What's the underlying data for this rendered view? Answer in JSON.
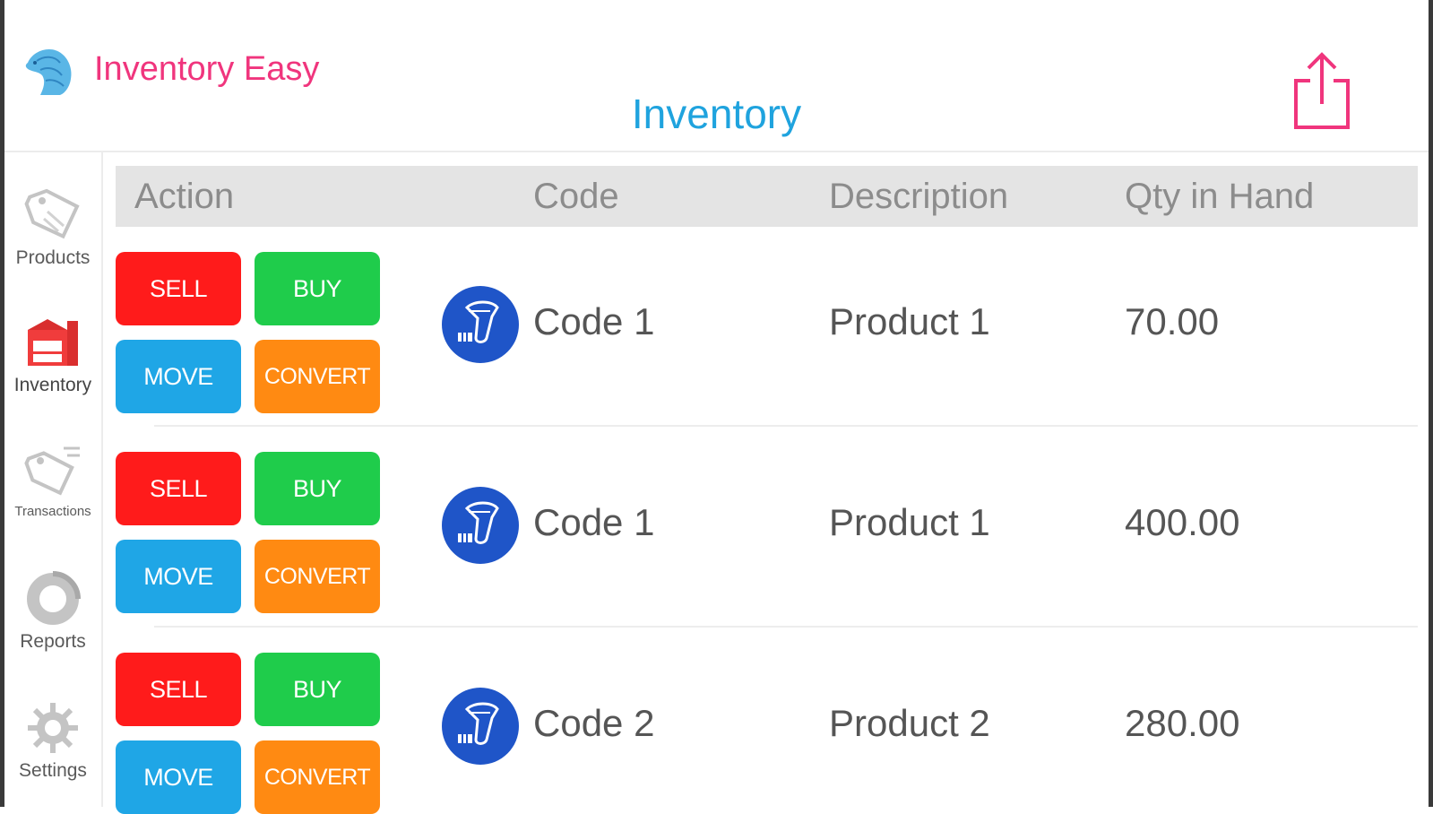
{
  "header": {
    "brand": "Inventory Easy",
    "title": "Inventory"
  },
  "sidebar": {
    "items": [
      {
        "label": "Products",
        "icon": "tag-icon",
        "active": false
      },
      {
        "label": "Inventory",
        "icon": "warehouse-icon",
        "active": true
      },
      {
        "label": "Transactions",
        "icon": "tag-list-icon",
        "active": false
      },
      {
        "label": "Reports",
        "icon": "donut-chart-icon",
        "active": false
      },
      {
        "label": "Settings",
        "icon": "gear-icon",
        "active": false
      }
    ]
  },
  "table": {
    "columns": [
      "Action",
      "Code",
      "Description",
      "Qty in Hand"
    ],
    "actions": {
      "sell": "SELL",
      "buy": "BUY",
      "move": "MOVE",
      "convert": "CONVERT"
    },
    "rows": [
      {
        "code": "Code 1",
        "description": "Product 1",
        "qty": "70.00"
      },
      {
        "code": "Code 1",
        "description": "Product 1",
        "qty": "400.00"
      },
      {
        "code": "Code 2",
        "description": "Product 2",
        "qty": "280.00"
      }
    ]
  },
  "colors": {
    "brand": "#f0357d",
    "title": "#1fa3de",
    "sell": "#ff1b1b",
    "buy": "#1fcc4b",
    "move": "#1fa6e6",
    "convert": "#ff8a12",
    "scanner": "#1f55c8"
  }
}
